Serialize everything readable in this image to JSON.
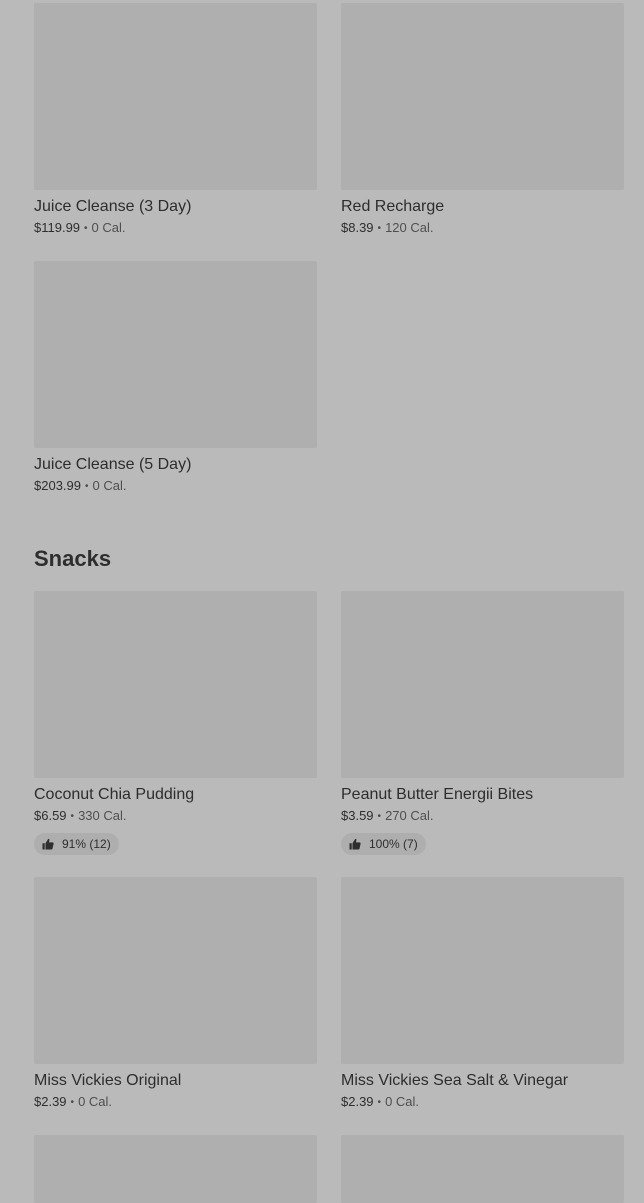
{
  "drinks": [
    {
      "name": "Juice Cleanse (3 Day)",
      "price": "$119.99",
      "separator": "•",
      "calories": "0 Cal."
    },
    {
      "name": "Red Recharge",
      "price": "$8.39",
      "separator": "•",
      "calories": "120 Cal."
    },
    {
      "name": "Juice Cleanse (5 Day)",
      "price": "$203.99",
      "separator": "•",
      "calories": "0 Cal."
    }
  ],
  "snacks_section": {
    "title": "Snacks",
    "items": [
      {
        "name": "Coconut Chia Pudding",
        "price": "$6.59",
        "separator": "•",
        "calories": "330 Cal.",
        "rating": "91% (12)"
      },
      {
        "name": "Peanut Butter Energii Bites",
        "price": "$3.59",
        "separator": "•",
        "calories": "270 Cal.",
        "rating": "100% (7)"
      },
      {
        "name": "Miss Vickies Original",
        "price": "$2.39",
        "separator": "•",
        "calories": "0 Cal."
      },
      {
        "name": "Miss Vickies Sea Salt & Vinegar",
        "price": "$2.39",
        "separator": "•",
        "calories": "0 Cal."
      }
    ]
  },
  "icons": {
    "rating": "thumbs-up-icon"
  },
  "colors": {
    "background": "#bababa",
    "image_placeholder": "#afafaf",
    "rating_pill": "#aeaeae"
  }
}
